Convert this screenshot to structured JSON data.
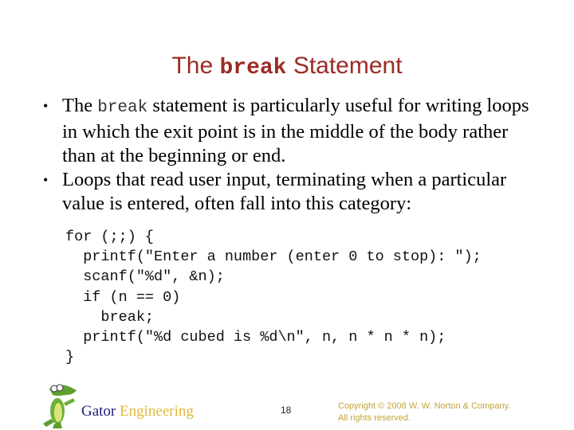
{
  "title": {
    "prefix": "The ",
    "code": "break",
    "suffix": " Statement"
  },
  "bullets": [
    {
      "pre": "The ",
      "code": "break",
      "post": " statement is particularly useful for writing loops in which the exit point is in the middle of the body rather than at the beginning or end."
    },
    {
      "pre": "Loops that read user input, terminating when a particular value is entered, often fall into this category:",
      "code": "",
      "post": ""
    }
  ],
  "code": "for (;;) {\n  printf(\"Enter a number (enter 0 to stop): \");\n  scanf(\"%d\", &n);\n  if (n == 0)\n    break;\n  printf(\"%d cubed is %d\\n\", n, n * n * n);\n}",
  "footer": {
    "brand_gator": "Gator",
    "brand_engineering": " Engineering",
    "page_number": "18",
    "copyright_line1": "Copyright © 2008 W. W. Norton & Company.",
    "copyright_line2": "All rights reserved.",
    "logo_icon": "gator-mascot-icon"
  },
  "colors": {
    "title": "#9b2b25",
    "brand_gator": "#1c1c7a",
    "brand_engineering": "#e0b83a",
    "copyright": "#c4a43a"
  }
}
